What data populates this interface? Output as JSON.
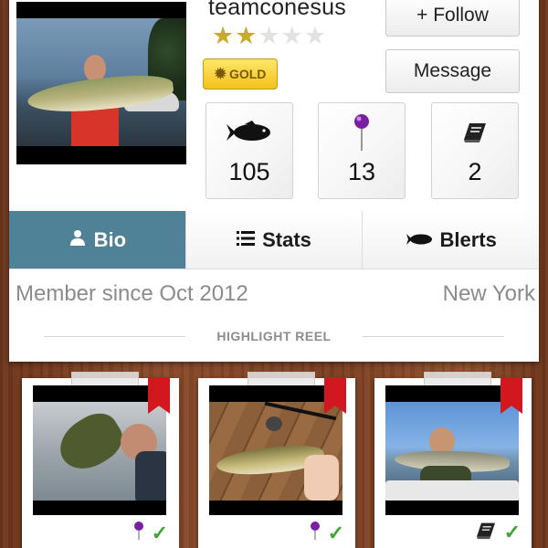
{
  "profile": {
    "username": "teamconesus",
    "rating": 2,
    "rating_max": 5,
    "badge_label": "GOLD",
    "follow_label": "+ Follow",
    "message_label": "Message"
  },
  "stats": {
    "fish_count": "105",
    "pins_count": "13",
    "logs_count": "2"
  },
  "tabs": [
    {
      "label": "Bio",
      "active": true
    },
    {
      "label": "Stats",
      "active": false
    },
    {
      "label": "Blerts",
      "active": false
    }
  ],
  "bio": {
    "member_since": "Member since Oct 2012",
    "location": "New York"
  },
  "highlight_reel": {
    "title": "HIGHLIGHT REEL"
  },
  "colors": {
    "active_tab": "#4f8296",
    "ribbon": "#d3171f",
    "gold": "#f3c21a",
    "check": "#3fa535",
    "pin": "#7a1fa2"
  }
}
